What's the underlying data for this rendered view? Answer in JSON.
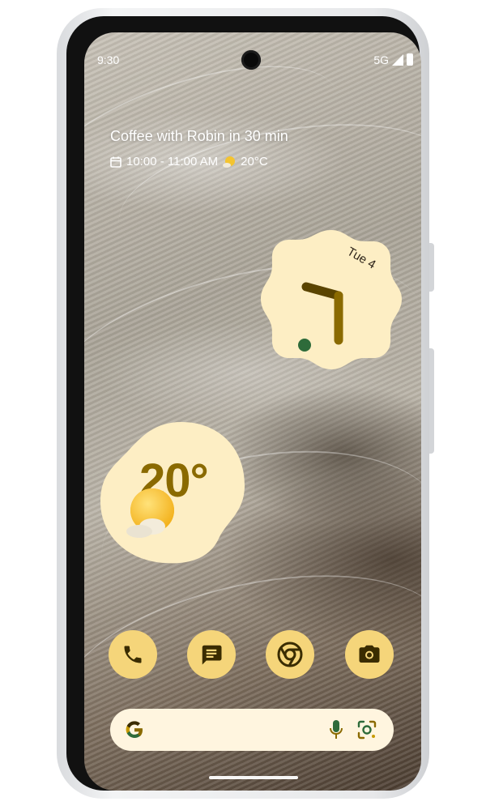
{
  "status_bar": {
    "time": "9:30",
    "network": "5G"
  },
  "glance": {
    "event_title": "Coffee with Robin in 30 min",
    "event_time": "10:00 - 11:00 AM",
    "temperature": "20°C"
  },
  "clock_widget": {
    "date": "Tue 4"
  },
  "weather_widget": {
    "temperature": "20°"
  },
  "dock": {
    "apps": [
      {
        "name": "phone-app",
        "icon": "phone-icon"
      },
      {
        "name": "messages-app",
        "icon": "message-icon"
      },
      {
        "name": "chrome-app",
        "icon": "chrome-icon"
      },
      {
        "name": "camera-app",
        "icon": "camera-icon"
      }
    ]
  },
  "search_bar": {
    "icons": [
      "google-g-icon",
      "microphone-icon",
      "lens-icon"
    ]
  },
  "colors": {
    "widget_bg": "#fdeec4",
    "accent": "#8a6a00",
    "dock_bg": "#f5d57a"
  }
}
